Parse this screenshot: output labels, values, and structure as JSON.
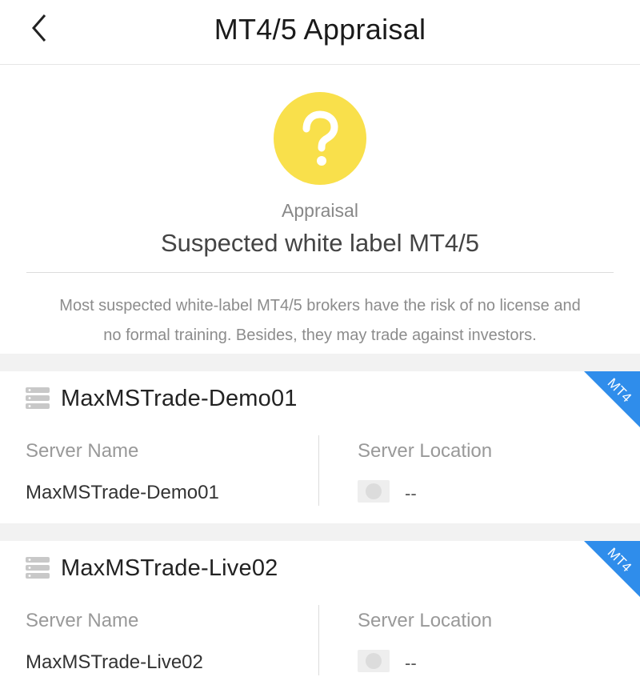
{
  "header": {
    "title": "MT4/5 Appraisal",
    "back_icon": "chevron-left-icon"
  },
  "appraisal": {
    "icon": "question-mark-icon",
    "badge_color": "#F9E04B",
    "label": "Appraisal",
    "verdict": "Suspected white label MT4/5",
    "description_line1": "Most suspected white-label MT4/5 brokers have the risk of no license and",
    "description_line2": "no formal training. Besides, they may trade against investors."
  },
  "servers": [
    {
      "title": "MaxMSTrade-Demo01",
      "tag": "MT4",
      "tag_color": "#2F8DEB",
      "server_name_label": "Server Name",
      "server_name": "MaxMSTrade-Demo01",
      "server_location_label": "Server Location",
      "server_location": "--"
    },
    {
      "title": "MaxMSTrade-Live02",
      "tag": "MT4",
      "tag_color": "#2F8DEB",
      "server_name_label": "Server Name",
      "server_name": "MaxMSTrade-Live02",
      "server_location_label": "Server Location",
      "server_location": "--"
    }
  ]
}
